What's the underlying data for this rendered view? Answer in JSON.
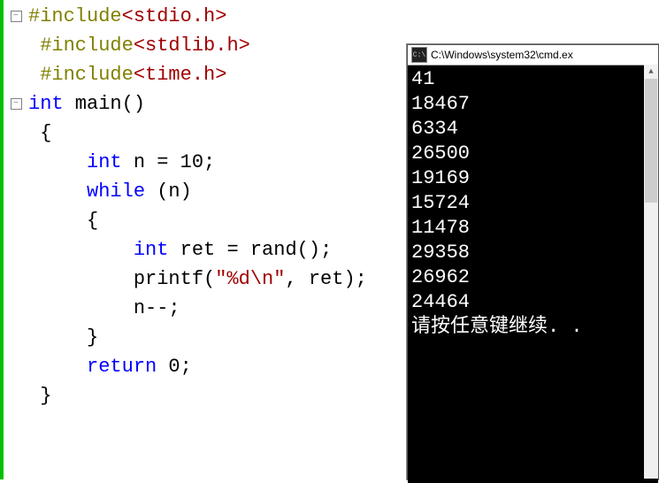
{
  "code": {
    "lines": [
      {
        "fold": "minus",
        "segments": [
          {
            "t": "#include",
            "c": "pp"
          },
          {
            "t": "<stdio.h>",
            "c": "hdr"
          }
        ]
      },
      {
        "fold": "none",
        "segments": [
          {
            "t": " #include",
            "c": "pp"
          },
          {
            "t": "<stdlib.h>",
            "c": "hdr"
          }
        ]
      },
      {
        "fold": "none",
        "segments": [
          {
            "t": " #include",
            "c": "pp"
          },
          {
            "t": "<time.h>",
            "c": "hdr"
          }
        ]
      },
      {
        "fold": "minus",
        "segments": [
          {
            "t": "int",
            "c": "kw"
          },
          {
            "t": " main()",
            "c": "fn"
          }
        ]
      },
      {
        "fold": "none",
        "segments": [
          {
            "t": " {",
            "c": "op"
          }
        ]
      },
      {
        "fold": "none",
        "segments": [
          {
            "t": "     ",
            "c": "op"
          },
          {
            "t": "int",
            "c": "kw"
          },
          {
            "t": " n = 10;",
            "c": "op"
          }
        ]
      },
      {
        "fold": "none",
        "segments": [
          {
            "t": "     ",
            "c": "op"
          },
          {
            "t": "while",
            "c": "kw"
          },
          {
            "t": " (n)",
            "c": "op"
          }
        ]
      },
      {
        "fold": "none",
        "segments": [
          {
            "t": "     {",
            "c": "op"
          }
        ]
      },
      {
        "fold": "none",
        "segments": [
          {
            "t": "         ",
            "c": "op"
          },
          {
            "t": "int",
            "c": "kw"
          },
          {
            "t": " ret = rand();",
            "c": "op"
          }
        ]
      },
      {
        "fold": "none",
        "segments": [
          {
            "t": "         printf(",
            "c": "op"
          },
          {
            "t": "\"%d\\n\"",
            "c": "str"
          },
          {
            "t": ", ret);",
            "c": "op"
          }
        ]
      },
      {
        "fold": "none",
        "segments": [
          {
            "t": "         n--;",
            "c": "op"
          }
        ]
      },
      {
        "fold": "none",
        "segments": [
          {
            "t": "     }",
            "c": "op"
          }
        ]
      },
      {
        "fold": "none",
        "segments": [
          {
            "t": "     ",
            "c": "op"
          },
          {
            "t": "return",
            "c": "kw"
          },
          {
            "t": " 0;",
            "c": "op"
          }
        ]
      },
      {
        "fold": "none",
        "segments": [
          {
            "t": " }",
            "c": "op"
          }
        ]
      }
    ]
  },
  "console": {
    "title": "C:\\Windows\\system32\\cmd.ex",
    "icon_label": "C:\\",
    "output_lines": [
      "41",
      "18467",
      "6334",
      "26500",
      "19169",
      "15724",
      "11478",
      "29358",
      "26962",
      "24464",
      "请按任意键继续. ."
    ]
  }
}
